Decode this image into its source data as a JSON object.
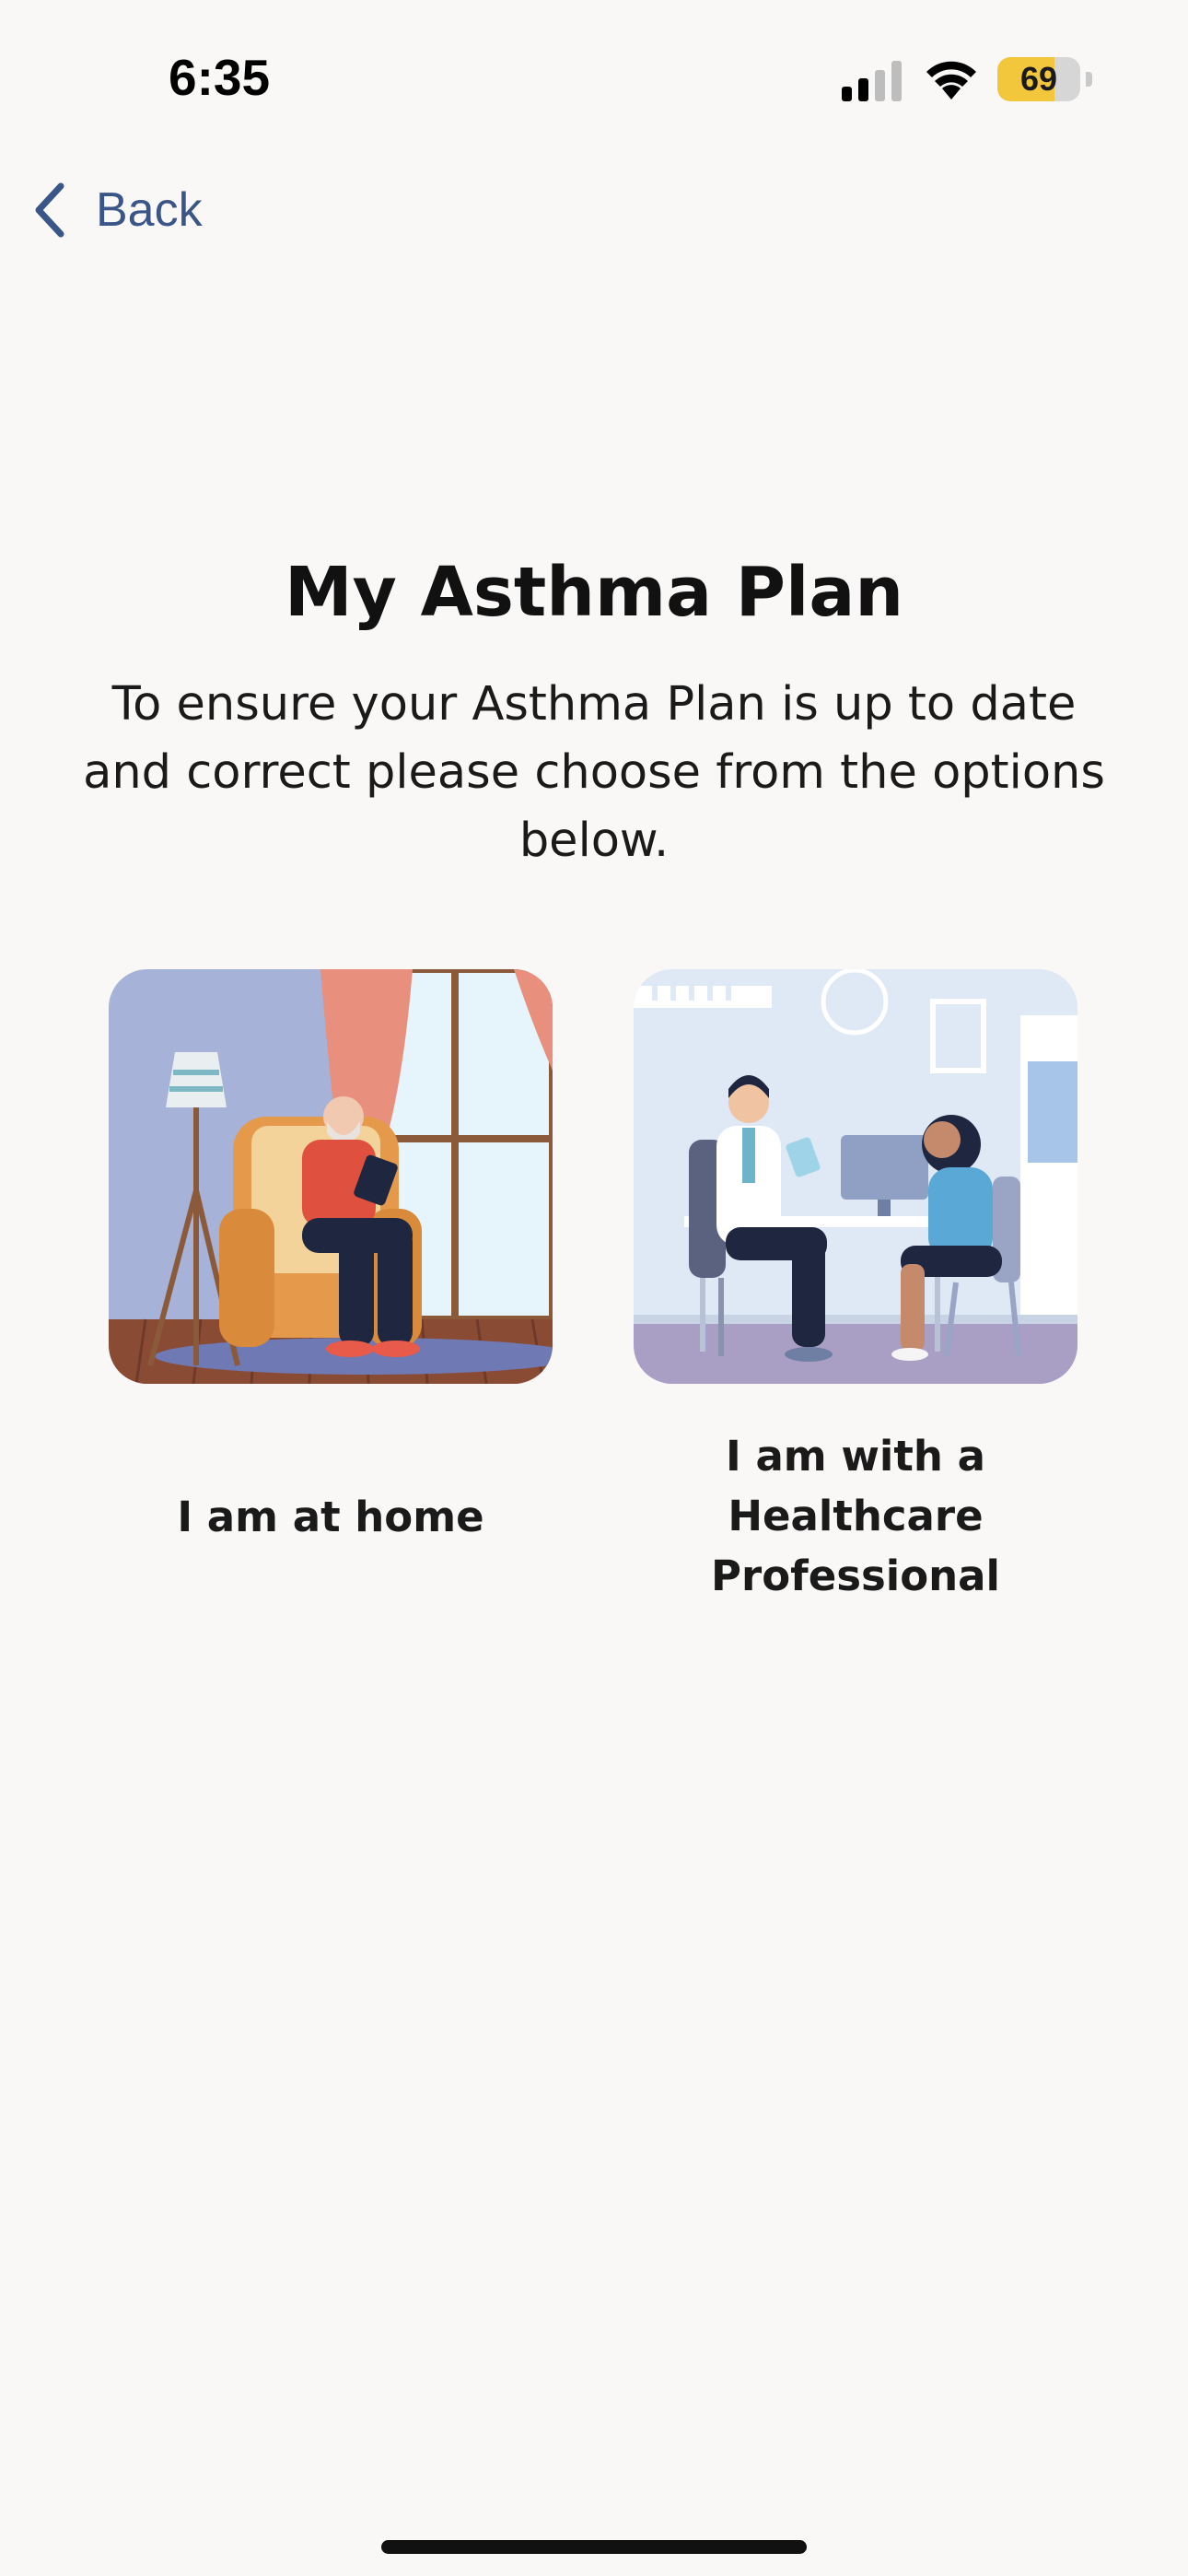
{
  "status_bar": {
    "time": "6:35",
    "battery_level": "69",
    "battery_fraction": 0.69,
    "icons": [
      "signal-icon",
      "wifi-icon",
      "battery-icon"
    ]
  },
  "nav": {
    "back_label": "Back",
    "accent_color": "#3a5688"
  },
  "main": {
    "title": "My Asthma Plan",
    "subtitle": "To ensure your Asthma Plan is up to date and correct please choose from the options below.",
    "options": [
      {
        "label": "I am at home",
        "illustration": "person-in-armchair-with-tablet"
      },
      {
        "label": "I am with a Healthcare Professional",
        "illustration": "doctor-and-patient-at-desk"
      }
    ]
  }
}
